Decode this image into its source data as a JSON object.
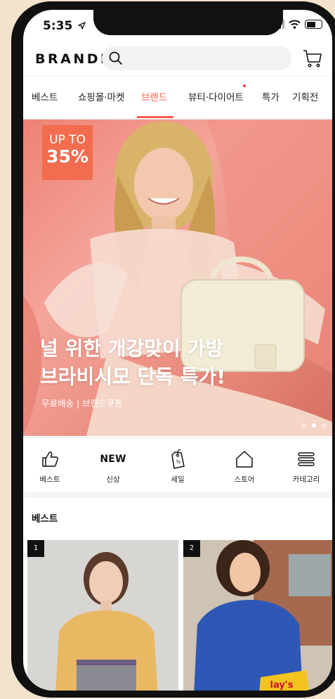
{
  "status_bar": {
    "time": "5:35",
    "location_icon": "location-arrow-icon"
  },
  "header": {
    "logo": "BRANDI",
    "search_icon": "search-icon",
    "cart_icon": "cart-icon"
  },
  "tabs": [
    {
      "label": "베스트",
      "active": false
    },
    {
      "label": "쇼핑몰·마켓",
      "active": false
    },
    {
      "label": "브랜드",
      "active": true
    },
    {
      "label": "뷰티·다이어트",
      "active": false,
      "has_dot": true
    },
    {
      "label": "특가",
      "active": false
    },
    {
      "label": "기획전",
      "active": false
    }
  ],
  "banner": {
    "badge_line1": "UP TO",
    "badge_line2": "35%",
    "title_line1": "널 위한 개강맞이 가방",
    "title_line2": "브라비시모 단독 특가!",
    "subtitle": "무료배송 | 브랜드쿠폰",
    "slides_total": 3,
    "slide_active": 2
  },
  "quick_menu": [
    {
      "label": "베스트",
      "icon": "thumbs-up-icon"
    },
    {
      "label": "신상",
      "icon_text": "NEW"
    },
    {
      "label": "세일",
      "icon": "price-tag-icon"
    },
    {
      "label": "스토어",
      "icon": "home-icon"
    },
    {
      "label": "카테고리",
      "icon": "menu-icon"
    }
  ],
  "best": {
    "title": "베스트",
    "products": [
      {
        "rank": "1"
      },
      {
        "rank": "2"
      }
    ]
  },
  "colors": {
    "accent": "#ff5d4d",
    "badge": "#f26c4f",
    "frame": "#111111"
  }
}
